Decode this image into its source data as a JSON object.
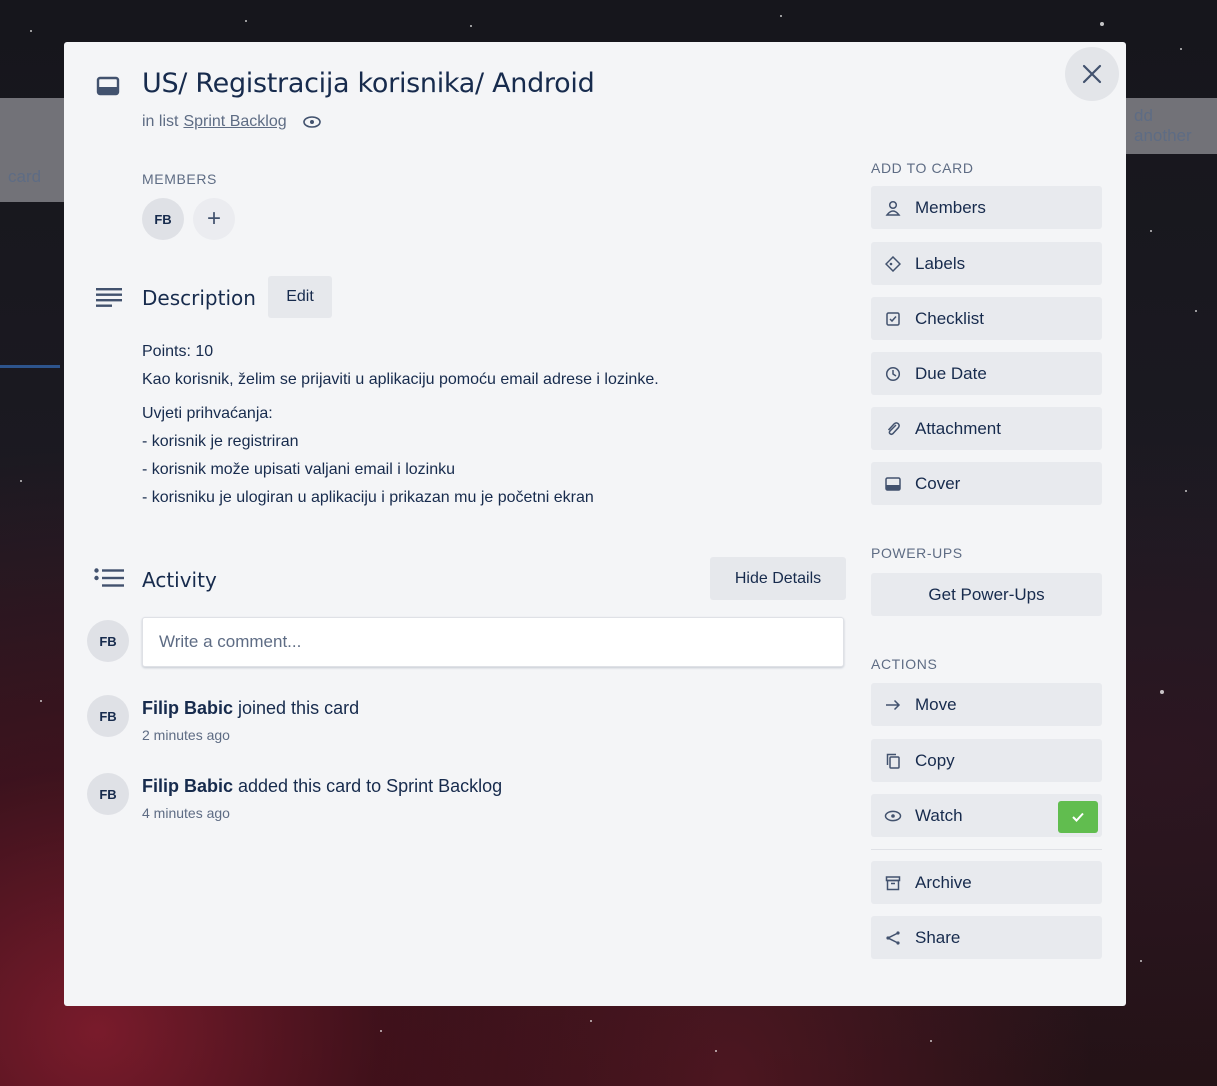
{
  "background": {
    "top_text": "",
    "left_fragment": "card",
    "right_fragment": "dd another"
  },
  "card": {
    "title": "US/ Registracija korisnika/ Android",
    "in_list_prefix": "in list",
    "list_name": "Sprint Backlog"
  },
  "members": {
    "label": "MEMBERS",
    "avatar_initials": "FB",
    "add_symbol": "+"
  },
  "description": {
    "title": "Description",
    "edit_label": "Edit",
    "lines": [
      "Points: 10",
      "Kao korisnik, želim se prijaviti u aplikaciju pomoću email adrese i lozinke.",
      "Uvjeti prihvaćanja:",
      "- korisnik je registriran",
      "- korisnik može upisati valjani email i lozinku",
      "- korisniku je ulogiran u aplikaciju i prikazan mu je početni ekran"
    ]
  },
  "activity": {
    "title": "Activity",
    "hide_details_label": "Hide Details",
    "comment_placeholder": "Write a comment...",
    "avatar_initials": "FB",
    "entries": [
      {
        "user": "Filip Babic",
        "text": " joined this card",
        "time": "2 minutes ago"
      },
      {
        "user": "Filip Babic",
        "text": " added this card to Sprint Backlog",
        "time": "4 minutes ago"
      }
    ]
  },
  "sidebar": {
    "add_to_card_label": "ADD TO CARD",
    "add_to_card": [
      {
        "label": "Members",
        "icon": "person-icon"
      },
      {
        "label": "Labels",
        "icon": "tag-icon"
      },
      {
        "label": "Checklist",
        "icon": "checklist-icon"
      },
      {
        "label": "Due Date",
        "icon": "clock-icon"
      },
      {
        "label": "Attachment",
        "icon": "paperclip-icon"
      },
      {
        "label": "Cover",
        "icon": "cover-icon"
      }
    ],
    "power_ups_label": "POWER-UPS",
    "get_power_ups_label": "Get Power-Ups",
    "actions_label": "ACTIONS",
    "actions": [
      {
        "label": "Move",
        "icon": "arrow-right-icon"
      },
      {
        "label": "Copy",
        "icon": "copy-icon"
      },
      {
        "label": "Watch",
        "icon": "eye-icon",
        "checked": true
      },
      {
        "label": "Archive",
        "icon": "archive-icon"
      },
      {
        "label": "Share",
        "icon": "share-icon"
      }
    ]
  },
  "colors": {
    "modal_bg": "#f4f5f7",
    "button_bg": "#e8eaee",
    "text": "#172b4d",
    "muted": "#5e6c84",
    "watch_check": "#61bd4f"
  }
}
